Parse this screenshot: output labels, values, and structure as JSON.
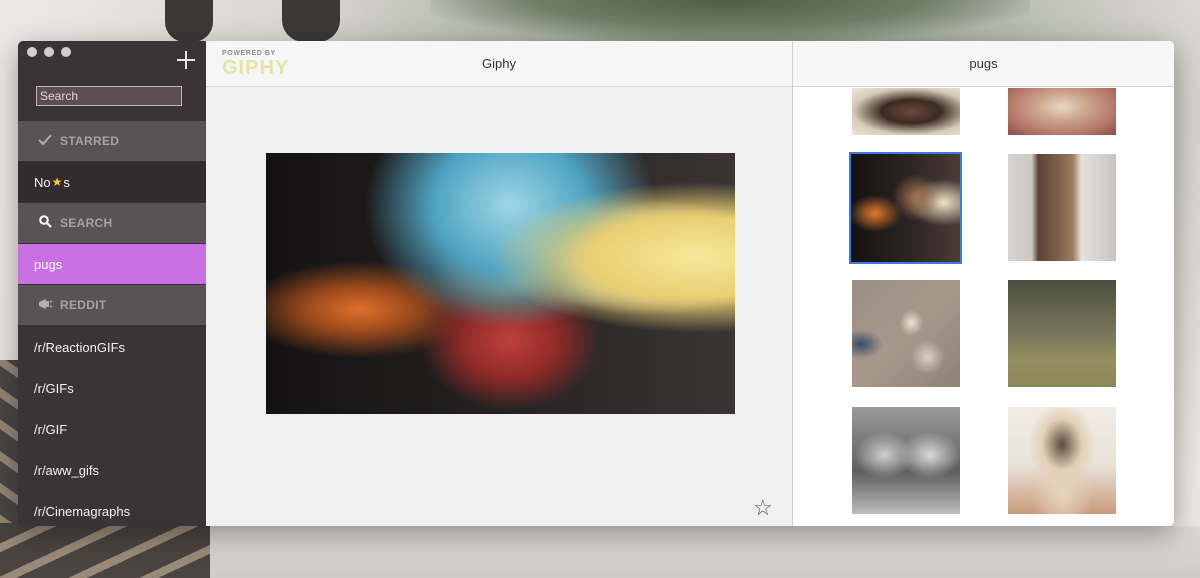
{
  "sidebar": {
    "search": {
      "placeholder": "Search"
    },
    "starred": {
      "icon": "checkmark-icon",
      "label": "STARRED",
      "empty_text_before": "No",
      "empty_star": "★",
      "empty_text_after": "s"
    },
    "search_section": {
      "icon": "magnifier-icon",
      "label": "SEARCH",
      "items": [
        {
          "label": "pugs",
          "active": true
        }
      ]
    },
    "reddit": {
      "icon": "megaphone-icon",
      "label": "REDDIT",
      "items": [
        {
          "label": "/r/ReactionGIFs"
        },
        {
          "label": "/r/GIFs"
        },
        {
          "label": "/r/GIF"
        },
        {
          "label": "/r/aww_gifs"
        },
        {
          "label": "/r/Cinemagraphs"
        }
      ]
    }
  },
  "main": {
    "logo": {
      "powered": "POWERED BY",
      "brand": "GIPHY"
    },
    "title": "Giphy",
    "star_icon": "star-outline-icon"
  },
  "results": {
    "title": "pugs",
    "thumbnails": [
      {
        "name": "thumb-1"
      },
      {
        "name": "thumb-2"
      },
      {
        "name": "thumb-3",
        "selected": true
      },
      {
        "name": "thumb-4"
      },
      {
        "name": "thumb-5"
      },
      {
        "name": "thumb-6"
      },
      {
        "name": "thumb-7"
      },
      {
        "name": "thumb-8"
      }
    ]
  },
  "colors": {
    "accent": "#c96fe3",
    "sidebar_bg": "#3b3436",
    "selection_border": "#3e7bd6",
    "giphy_yellow": "#e5e3a6"
  }
}
